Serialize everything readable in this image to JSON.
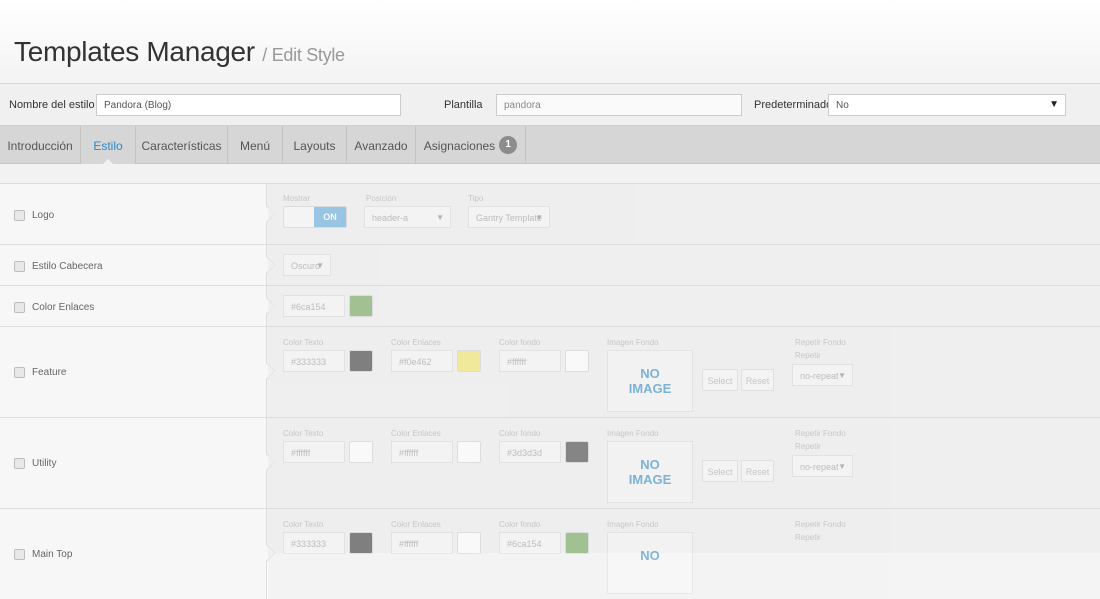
{
  "header": {
    "title": "Templates Manager",
    "subtitle": "/ Edit Style"
  },
  "form": {
    "style_name_label": "Nombre del estilo *",
    "style_name_value": "Pandora (Blog)",
    "template_label": "Plantilla",
    "template_value": "pandora",
    "default_label": "Predeterminado",
    "default_value": "No"
  },
  "tabs": [
    {
      "label": "Introducción"
    },
    {
      "label": "Estilo"
    },
    {
      "label": "Características"
    },
    {
      "label": "Menú"
    },
    {
      "label": "Layouts"
    },
    {
      "label": "Avanzado"
    },
    {
      "label": "Asignaciones",
      "badge": "1"
    }
  ],
  "rows": {
    "logo": {
      "name": "Logo",
      "show_caption": "Mostrar",
      "show_value": "ON",
      "position_caption": "Posición",
      "position_value": "header-a",
      "type_caption": "Tipo",
      "type_value": "Gantry Template"
    },
    "header_style": {
      "name": "Estilo Cabecera",
      "value": "Oscuro"
    },
    "link_color": {
      "name": "Color Enlaces",
      "value": "#6ca154",
      "swatch": "#6ca154"
    },
    "feature": {
      "name": "Feature",
      "text_caption": "Color Texto",
      "text_value": "#333333",
      "text_swatch": "#333333",
      "link_caption": "Color Enlaces",
      "link_value": "#f0e462",
      "link_swatch": "#f0e462",
      "bg_caption": "Color fondo",
      "bg_value": "#ffffff",
      "bg_swatch": "#ffffff",
      "img_caption": "Imagen Fondo",
      "img_text1": "NO",
      "img_text2": "IMAGE",
      "select_label": "Select",
      "reset_label": "Reset",
      "repeat_caption": "Repetir Fondo",
      "repeat_sub": "Repetir",
      "repeat_value": "no-repeat"
    },
    "utility": {
      "name": "Utility",
      "text_caption": "Color Texto",
      "text_value": "#ffffff",
      "text_swatch": "#ffffff",
      "link_caption": "Color Enlaces",
      "link_value": "#ffffff",
      "link_swatch": "#ffffff",
      "bg_caption": "Color fondo",
      "bg_value": "#3d3d3d",
      "bg_swatch": "#3d3d3d",
      "img_caption": "Imagen Fondo",
      "img_text1": "NO",
      "img_text2": "IMAGE",
      "select_label": "Select",
      "reset_label": "Reset",
      "repeat_caption": "Repetir Fondo",
      "repeat_sub": "Repetir",
      "repeat_value": "no-repeat"
    },
    "main_top": {
      "name": "Main Top",
      "text_caption": "Color Texto",
      "text_value": "#333333",
      "text_swatch": "#333333",
      "link_caption": "Color Enlaces",
      "link_value": "#ffffff",
      "link_swatch": "#ffffff",
      "bg_caption": "Color fondo",
      "bg_value": "#6ca154",
      "bg_swatch": "#6ca154",
      "img_caption": "Imagen Fondo",
      "img_text1": "NO",
      "repeat_caption": "Repetir Fondo",
      "repeat_sub": "Repetir"
    }
  }
}
